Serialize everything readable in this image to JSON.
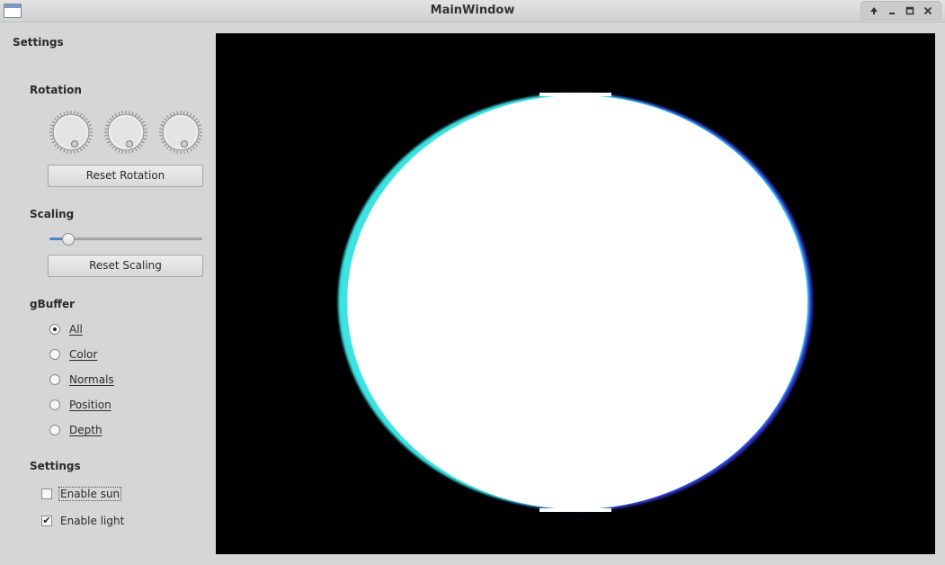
{
  "window": {
    "title": "MainWindow"
  },
  "panel": {
    "title": "Settings",
    "rotation": {
      "heading": "Rotation",
      "dials": [
        {
          "name": "dial-rotation-x"
        },
        {
          "name": "dial-rotation-y"
        },
        {
          "name": "dial-rotation-z"
        }
      ],
      "reset_label": "Reset Rotation"
    },
    "scaling": {
      "heading": "Scaling",
      "value_fraction": 0.09,
      "reset_label": "Reset Scaling"
    },
    "gbuffer": {
      "heading": "gBuffer",
      "options": [
        {
          "label": "All",
          "checked": true
        },
        {
          "label": "Color",
          "checked": false
        },
        {
          "label": "Normals",
          "checked": false
        },
        {
          "label": "Position",
          "checked": false
        },
        {
          "label": "Depth",
          "checked": false
        }
      ]
    },
    "settings": {
      "heading": "Settings",
      "checkboxes": [
        {
          "label": "Enable sun",
          "checked": false
        },
        {
          "label": "Enable light",
          "checked": true
        }
      ]
    }
  },
  "viewport": {
    "background": "#000000",
    "object_color": "#ffffff",
    "rim_left": "#40f0f0",
    "rim_right": "#3030d0"
  }
}
